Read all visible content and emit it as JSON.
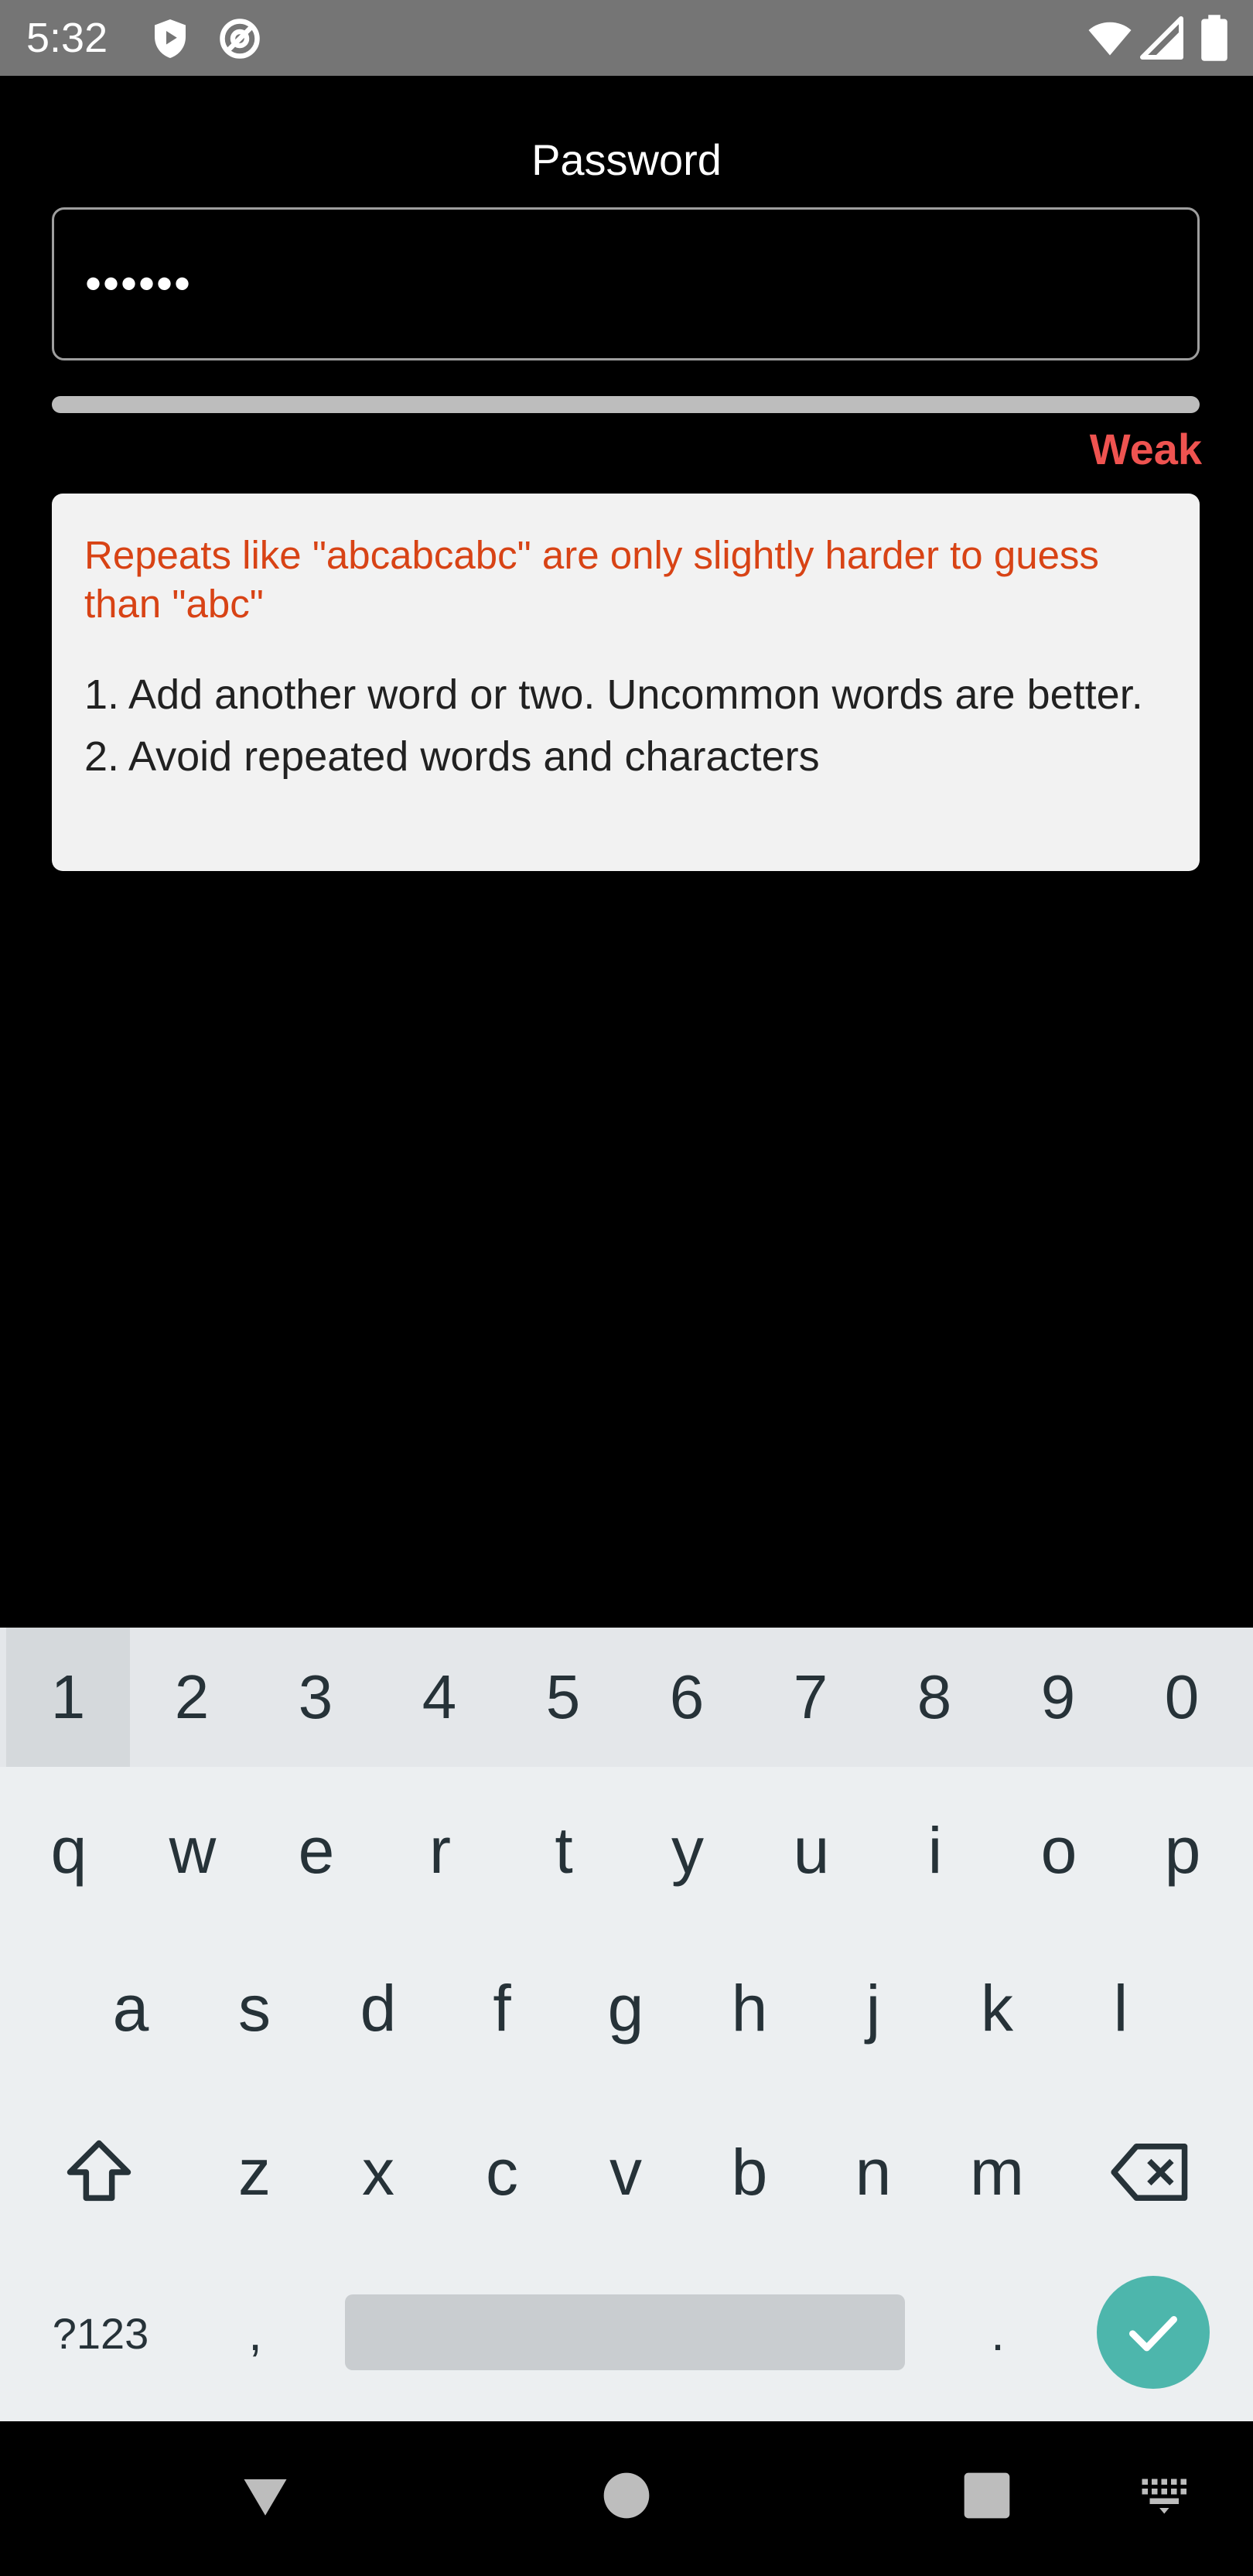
{
  "status_bar": {
    "time": "5:32",
    "left_icons": [
      "shield-icon",
      "at-sign-icon"
    ],
    "right_icons": [
      "wifi-icon",
      "cellular-signal-icon",
      "battery-icon"
    ]
  },
  "form": {
    "title": "Password",
    "password_value": "••••••",
    "strength_label": "Weak",
    "strength_level": 0,
    "strength_color": "#ef5350"
  },
  "feedback": {
    "warning": "Repeats like \"abcabcabc\" are only slightly harder to guess than \"abc\"",
    "suggestions": [
      "1. Add another word or two. Uncommon words are better.",
      "2. Avoid repeated words and characters"
    ]
  },
  "keyboard": {
    "number_row": [
      "1",
      "2",
      "3",
      "4",
      "5",
      "6",
      "7",
      "8",
      "9",
      "0"
    ],
    "row1": [
      "q",
      "w",
      "e",
      "r",
      "t",
      "y",
      "u",
      "i",
      "o",
      "p"
    ],
    "row2": [
      "a",
      "s",
      "d",
      "f",
      "g",
      "h",
      "j",
      "k",
      "l"
    ],
    "row3": [
      "z",
      "x",
      "c",
      "v",
      "b",
      "n",
      "m"
    ],
    "symbols_label": "?123",
    "comma_label": ",",
    "period_label": ".",
    "shift_icon": "shift-icon",
    "delete_icon": "backspace-icon",
    "enter_icon": "check-icon",
    "accent_color": "#4db6ac"
  },
  "nav_bar": {
    "icons": [
      "back-triangle-icon",
      "home-circle-icon",
      "recents-square-icon",
      "keyboard-switch-icon"
    ]
  }
}
